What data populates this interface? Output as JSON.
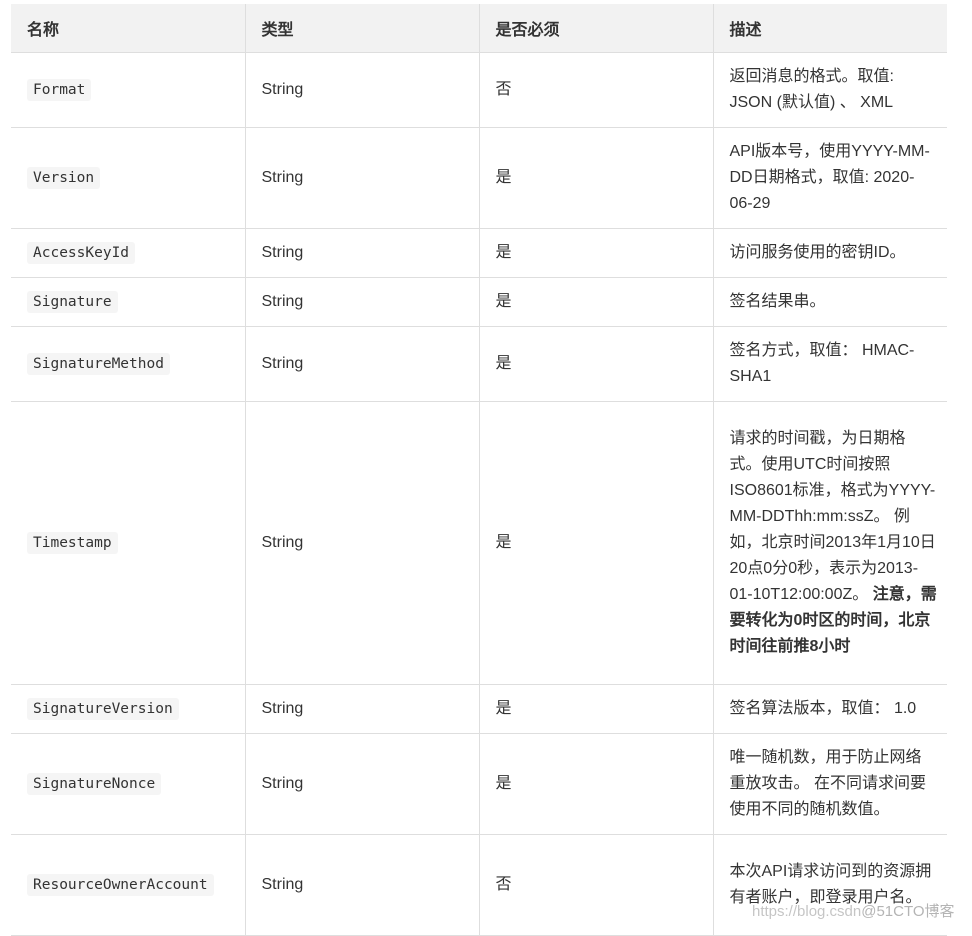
{
  "table": {
    "headers": [
      "名称",
      "类型",
      "是否必须",
      "描述"
    ],
    "rows": [
      {
        "name": "Format",
        "type": "String",
        "required": "否",
        "description": "返回消息的格式。取值: JSON (默认值) 、 XML",
        "description_strong": ""
      },
      {
        "name": "Version",
        "type": "String",
        "required": "是",
        "description": "API版本号，使用YYYY-MM-DD日期格式，取值: 2020-06-29",
        "description_strong": ""
      },
      {
        "name": "AccessKeyId",
        "type": "String",
        "required": "是",
        "description": "访问服务使用的密钥ID。",
        "description_strong": ""
      },
      {
        "name": "Signature",
        "type": "String",
        "required": "是",
        "description": "签名结果串。",
        "description_strong": ""
      },
      {
        "name": "SignatureMethod",
        "type": "String",
        "required": "是",
        "description": "签名方式，取值： HMAC-SHA1",
        "description_strong": ""
      },
      {
        "name": "Timestamp",
        "type": "String",
        "required": "是",
        "description": "请求的时间戳，为日期格式。使用UTC时间按照ISO8601标准，格式为YYYY-MM-DDThh:mm:ssZ。 例如，北京时间2013年1月10日20点0分0秒，表示为2013-01-10T12:00:00Z。 ",
        "description_strong": "注意，需要转化为0时区的时间，北京时间往前推8小时"
      },
      {
        "name": "SignatureVersion",
        "type": "String",
        "required": "是",
        "description": "签名算法版本，取值： 1.0",
        "description_strong": ""
      },
      {
        "name": "SignatureNonce",
        "type": "String",
        "required": "是",
        "description": "唯一随机数，用于防止网络重放攻击。 在不同请求间要使用不同的随机数值。",
        "description_strong": ""
      },
      {
        "name": "ResourceOwnerAccount",
        "type": "String",
        "required": "否",
        "description": "本次API请求访问到的资源拥有者账户，即登录用户名。",
        "description_strong": ""
      }
    ]
  },
  "watermark": {
    "url_text": "https://blog.csdn",
    "brand_text": "@51CTO博客"
  }
}
